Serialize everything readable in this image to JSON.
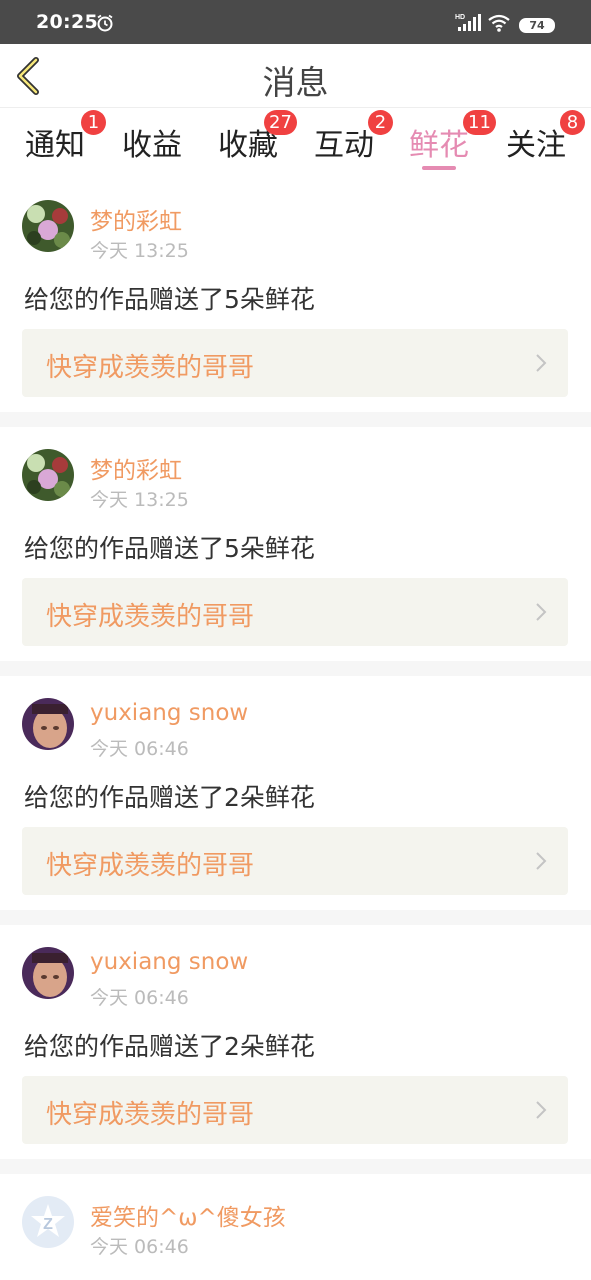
{
  "status_bar": {
    "time": "20:25",
    "battery": "74",
    "icons": [
      "alarm-icon",
      "hd-signal-icon",
      "wifi-icon",
      "battery-icon"
    ]
  },
  "header": {
    "title": "消息",
    "back_icon": "chevron-left-icon"
  },
  "colors": {
    "accent_pink": "#e58bb2",
    "username_orange": "#f09a62",
    "badge_red": "#f04141",
    "status_bar_bg": "#4a4a4a",
    "card_link_bg": "#f4f4ee"
  },
  "tabs": [
    {
      "label": "通知",
      "badge": "1"
    },
    {
      "label": "收益",
      "badge": ""
    },
    {
      "label": "收藏",
      "badge": "27"
    },
    {
      "label": "互动",
      "badge": "2"
    },
    {
      "label": "鲜花",
      "badge": "11",
      "active": true
    },
    {
      "label": "关注",
      "badge": "8"
    }
  ],
  "notifications": [
    {
      "username": "梦的彩虹",
      "time": "今天 13:25",
      "message": "给您的作品赠送了5朵鲜花",
      "work": "快穿成羡羡的哥哥",
      "avatar": "flower-avatar"
    },
    {
      "username": "梦的彩虹",
      "time": "今天 13:25",
      "message": "给您的作品赠送了5朵鲜花",
      "work": "快穿成羡羡的哥哥",
      "avatar": "flower-avatar"
    },
    {
      "username": "yuxiang snow",
      "time": "今天 06:46",
      "message": "给您的作品赠送了2朵鲜花",
      "work": "快穿成羡羡的哥哥",
      "avatar": "person-avatar"
    },
    {
      "username": "yuxiang snow",
      "time": "今天 06:46",
      "message": "给您的作品赠送了2朵鲜花",
      "work": "快穿成羡羡的哥哥",
      "avatar": "person-avatar"
    },
    {
      "username": "爱笑的^ω^傻女孩",
      "time": "今天 06:46",
      "message": "",
      "work": "",
      "avatar": "default-z-avatar"
    }
  ]
}
